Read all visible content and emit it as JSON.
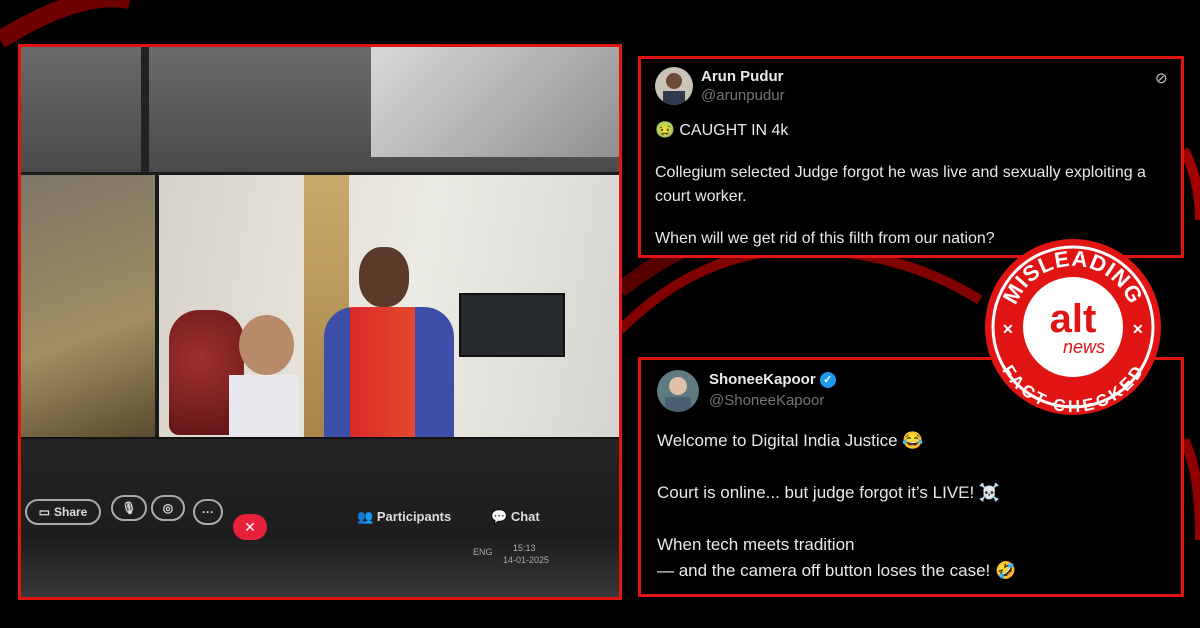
{
  "video": {
    "share_label": "Share",
    "participants_label": "Participants",
    "chat_label": "Chat",
    "end_symbol": "✕",
    "more_symbol": "···",
    "taskbar_left_text": "ENG",
    "taskbar_time": "15:13",
    "taskbar_date": "14-01-2025"
  },
  "tweet1": {
    "name": "Arun Pudur",
    "handle": "@arunpudur",
    "line1": "🤢 CAUGHT IN 4k",
    "line2": "Collegium selected Judge forgot he was live and sexually exploiting a court worker.",
    "line3": "When will we get rid of this filth from our nation?"
  },
  "tweet2": {
    "name": "ShoneeKapoor",
    "handle": "@ShoneeKapoor",
    "line1": "Welcome to Digital India Justice 😂",
    "line2": "Court is online... but judge forgot it’s LIVE! ☠️",
    "line3": "When tech meets tradition",
    "line4": "— and the camera off button loses the case! 🤣"
  },
  "stamp": {
    "top_text": "MISLEADING",
    "bottom_text": "FACT-CHECKED",
    "logo_alt": "alt",
    "logo_news": "news"
  },
  "colors": {
    "accent_red": "#e11414",
    "verified_blue": "#1d9bf0"
  }
}
